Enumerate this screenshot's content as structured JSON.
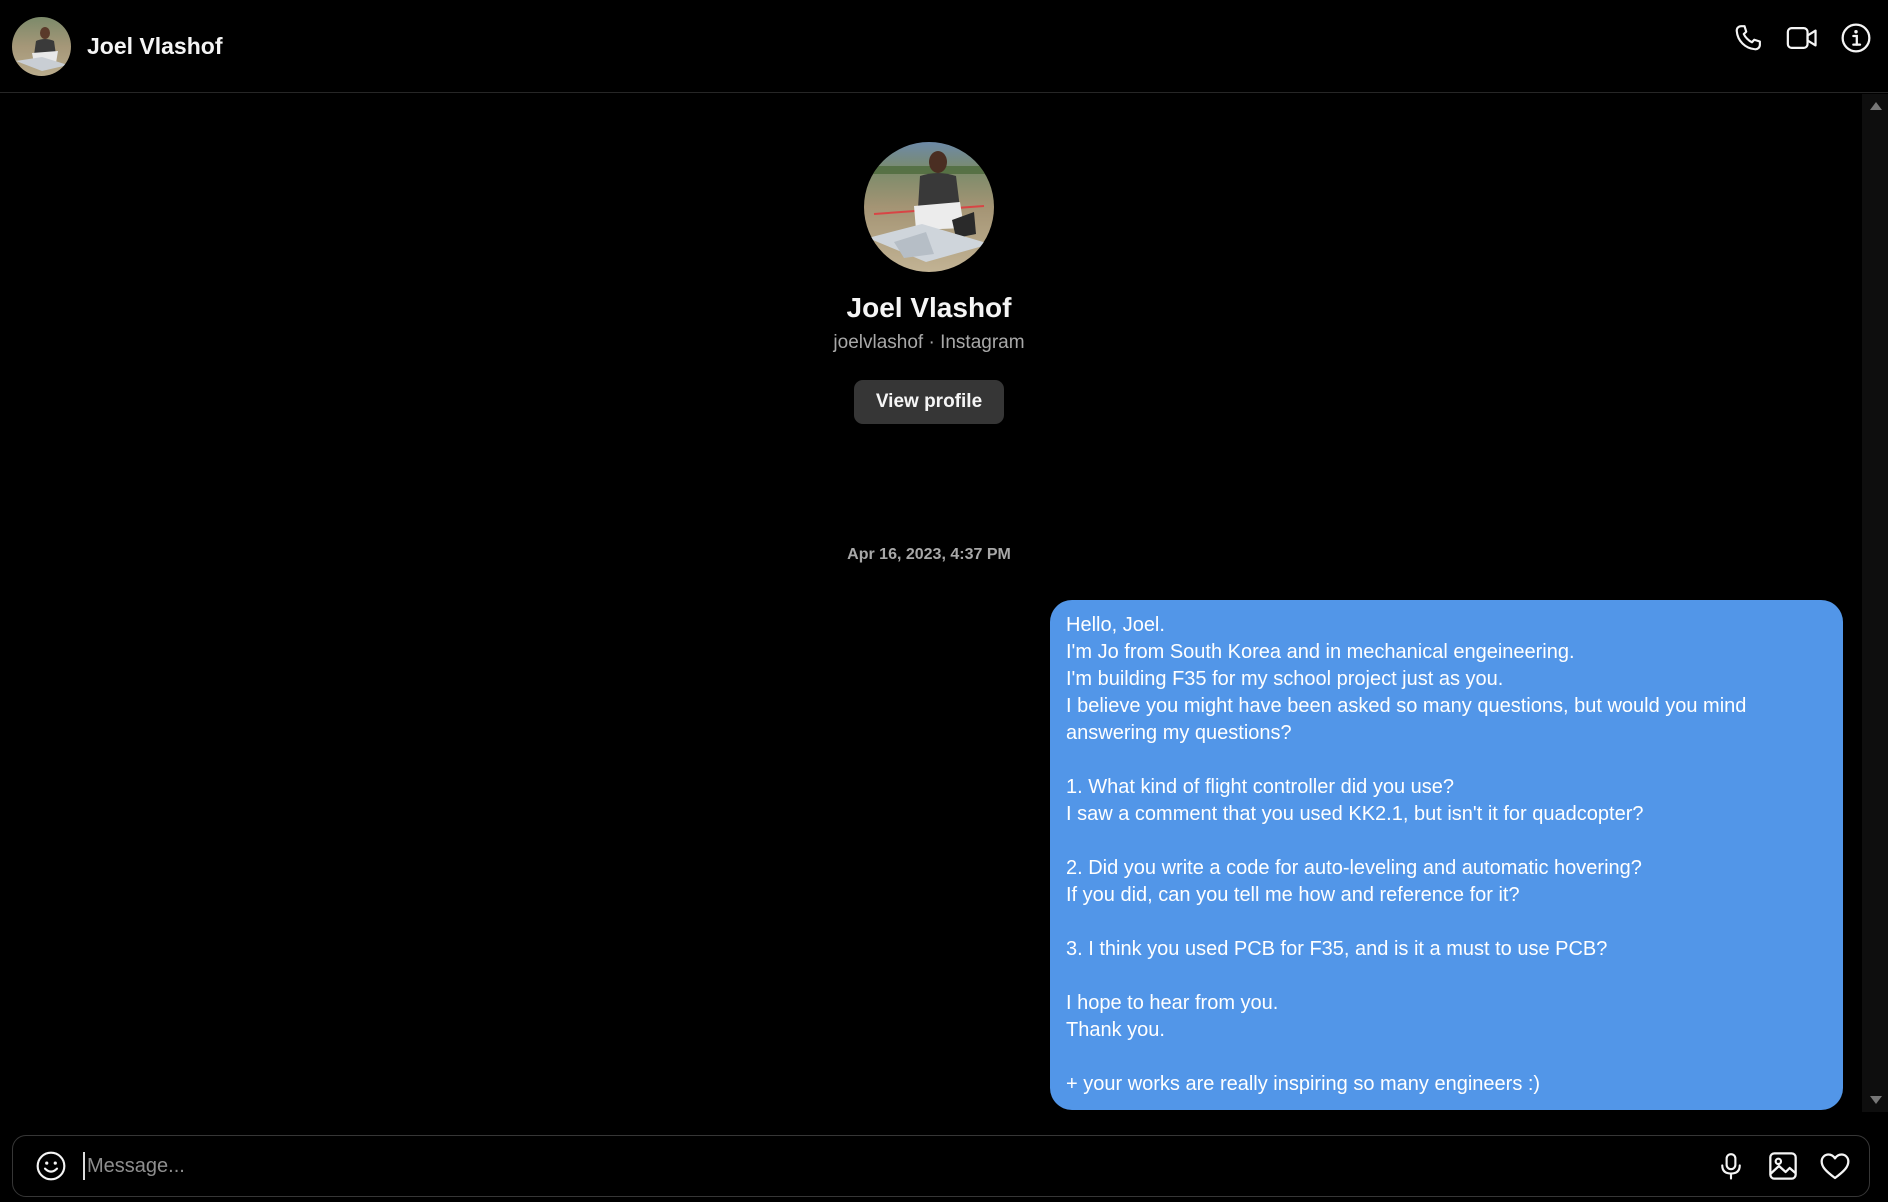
{
  "header": {
    "name": "Joel Vlashof",
    "avatar_icon": "user-avatar-photo",
    "actions": [
      {
        "name": "audio-call",
        "icon": "phone-icon"
      },
      {
        "name": "video-call",
        "icon": "video-camera-icon"
      },
      {
        "name": "conversation-info",
        "icon": "info-icon"
      }
    ]
  },
  "profile": {
    "name": "Joel Vlashof",
    "subtitle": "joelvlashof · Instagram",
    "view_profile_label": "View profile"
  },
  "thread": {
    "timestamp": "Apr 16, 2023, 4:37 PM",
    "message": {
      "bubble_color": "#5296e8",
      "lines": [
        "Hello, Joel.",
        "I'm Jo from South Korea and in mechanical engeineering.",
        "I'm building F35 for my school project just as you.",
        "I believe you might have been asked so many questions, but would you mind",
        "answering my questions?",
        "",
        "1. What kind of flight controller did you use?",
        "I saw a comment that you used KK2.1, but isn't it for quadcopter?",
        "",
        "2. Did you write a code for auto-leveling and automatic hovering?",
        "If you did, can you tell me how and reference for it?",
        "",
        "3. I think you used PCB for F35, and is it a must to use PCB?",
        "",
        "I hope to hear from you.",
        "Thank you.",
        "",
        "+ your works are really inspiring so many engineers :)"
      ]
    }
  },
  "composer": {
    "placeholder": "Message...",
    "value": "",
    "emoji_icon": "emoji-icon",
    "actions": [
      {
        "name": "voice-message",
        "icon": "microphone-icon"
      },
      {
        "name": "add-photo",
        "icon": "image-icon"
      },
      {
        "name": "send-like",
        "icon": "heart-icon"
      }
    ]
  }
}
